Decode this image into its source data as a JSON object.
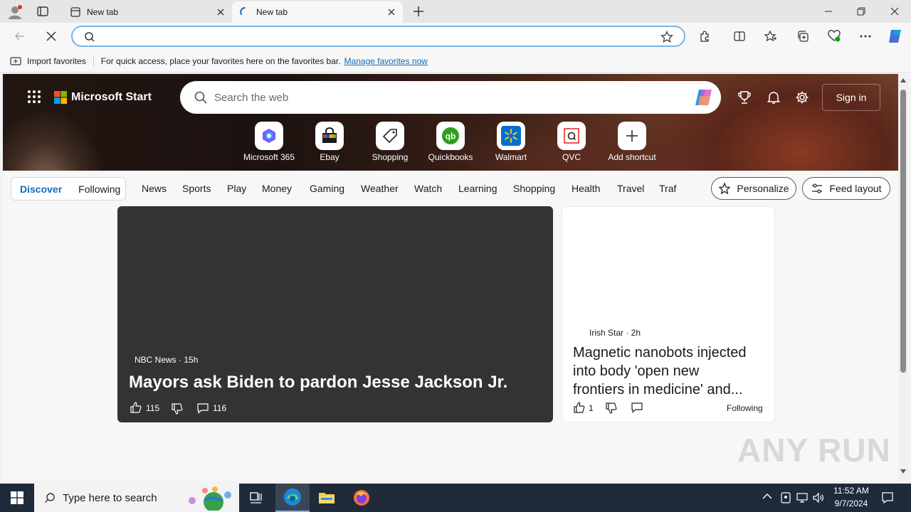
{
  "browser": {
    "tabs": [
      {
        "title": "New tab"
      },
      {
        "title": "New tab"
      }
    ],
    "address_bar": {
      "value": "",
      "placeholder": ""
    },
    "favorites_bar": {
      "import_label": "Import favorites",
      "message": "For quick access, place your favorites here on the favorites bar.",
      "manage_link": "Manage favorites now"
    }
  },
  "start_page": {
    "brand": "Microsoft Start",
    "search_placeholder": "Search the web",
    "sign_in_label": "Sign in",
    "shortcuts": [
      {
        "label": "Microsoft 365",
        "icon": "m365-icon"
      },
      {
        "label": "Ebay",
        "icon": "ebay-icon"
      },
      {
        "label": "Shopping",
        "icon": "price-tag-icon"
      },
      {
        "label": "Quickbooks",
        "icon": "quickbooks-icon"
      },
      {
        "label": "Walmart",
        "icon": "walmart-icon"
      },
      {
        "label": "QVC",
        "icon": "qvc-icon"
      },
      {
        "label": "Add shortcut",
        "icon": "plus-icon"
      }
    ],
    "nav": {
      "discover": "Discover",
      "following": "Following",
      "items": [
        "News",
        "Sports",
        "Play",
        "Money",
        "Gaming",
        "Weather",
        "Watch",
        "Learning",
        "Shopping",
        "Health",
        "Travel",
        "Traf"
      ],
      "personalize": "Personalize",
      "feed_layout": "Feed layout"
    },
    "cards": [
      {
        "source": "NBC News · 15h",
        "headline": "Mayors ask Biden to pardon Jesse Jackson Jr.",
        "likes": "115",
        "comments": "116"
      },
      {
        "source": "Irish Star · 2h",
        "headline_line1": "Magnetic nanobots injected",
        "headline_line2": "into body 'open new",
        "headline_line3": "frontiers in medicine' and...",
        "likes": "1",
        "follow_label": "Following"
      }
    ]
  },
  "taskbar": {
    "search_placeholder": "Type here to search",
    "time": "11:52 AM",
    "date": "9/7/2024"
  },
  "watermark": "ANY RUN",
  "colors": {
    "accent": "#0f6cbd",
    "taskbar": "#1f2a3a",
    "card_dark": "#333333"
  }
}
